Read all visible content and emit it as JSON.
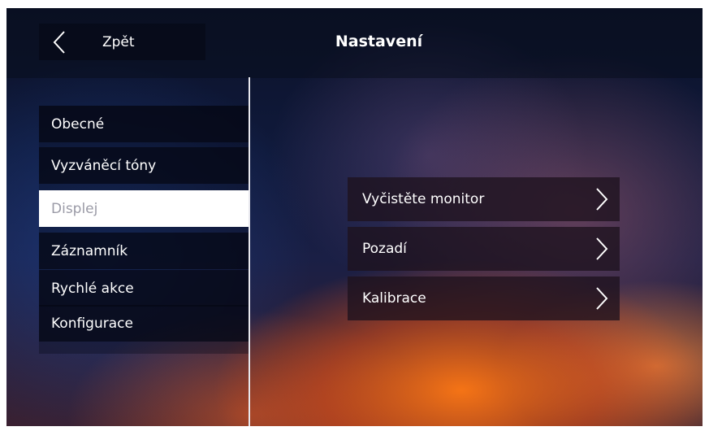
{
  "header": {
    "back_label": "Zpět",
    "title": "Nastavení",
    "back_icon": "chevron-left-icon"
  },
  "menu": {
    "items": [
      {
        "label": "Obecné",
        "active": false
      },
      {
        "label": "Vyzváněcí tóny",
        "active": false
      },
      {
        "label": "Displej",
        "active": true
      },
      {
        "label": "Záznamník",
        "active": false
      },
      {
        "label": "Rychlé akce",
        "active": false
      },
      {
        "label": "Konfigurace",
        "active": false
      }
    ]
  },
  "options": {
    "items": [
      {
        "label": "Vyčistěte monitor",
        "icon": "chevron-right-icon"
      },
      {
        "label": "Pozadí",
        "icon": "chevron-right-icon"
      },
      {
        "label": "Kalibrace",
        "icon": "chevron-right-icon"
      }
    ]
  },
  "colors": {
    "active_menu_bg": "#ffffff",
    "active_menu_text": "#9a9aa6",
    "text": "#ffffff"
  }
}
